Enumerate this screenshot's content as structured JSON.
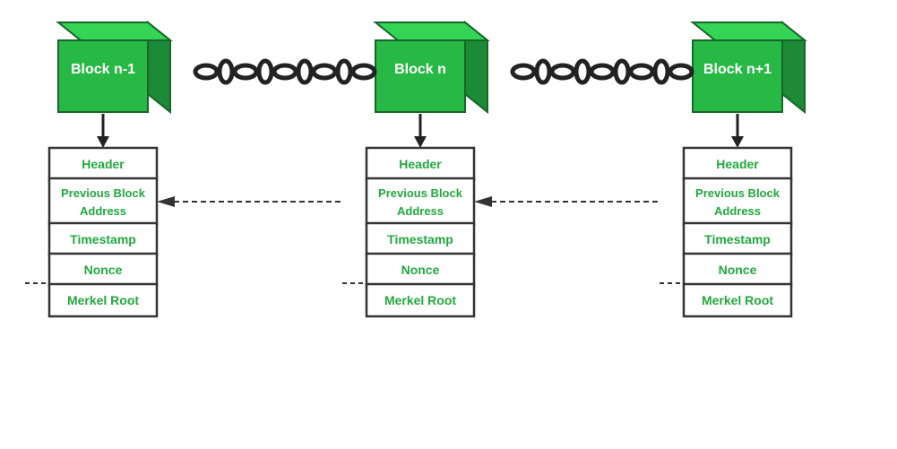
{
  "blocks": [
    {
      "id": "block-n-minus-1",
      "label": "Block n-1",
      "fields": [
        {
          "id": "header",
          "text": "Header"
        },
        {
          "id": "prev-block-addr",
          "text": "Previous Block\nAddress"
        },
        {
          "id": "timestamp",
          "text": "Timestamp"
        },
        {
          "id": "nonce",
          "text": "Nonce"
        },
        {
          "id": "merkel-root",
          "text": "Merkel Root"
        }
      ]
    },
    {
      "id": "block-n",
      "label": "Block n",
      "fields": [
        {
          "id": "header",
          "text": "Header"
        },
        {
          "id": "prev-block-addr",
          "text": "Previous Block\nAddress"
        },
        {
          "id": "timestamp",
          "text": "Timestamp"
        },
        {
          "id": "nonce",
          "text": "Nonce"
        },
        {
          "id": "merkel-root",
          "text": "Merkel Root"
        }
      ]
    },
    {
      "id": "block-n-plus-1",
      "label": "Block n+1",
      "fields": [
        {
          "id": "header",
          "text": "Header"
        },
        {
          "id": "prev-block-addr",
          "text": "Previous Block\nAddress"
        },
        {
          "id": "timestamp",
          "text": "Timestamp"
        },
        {
          "id": "nonce",
          "text": "Nonce"
        },
        {
          "id": "merkel-root",
          "text": "Merkel Root"
        }
      ]
    }
  ],
  "colors": {
    "cube_front": "#28b845",
    "cube_top": "#35d456",
    "cube_right": "#1d8a38",
    "cube_border": "#166628",
    "text_green": "#22a83e",
    "box_border": "#333",
    "chain_color": "#222",
    "arrow_color": "#222",
    "bg": "#ffffff"
  }
}
